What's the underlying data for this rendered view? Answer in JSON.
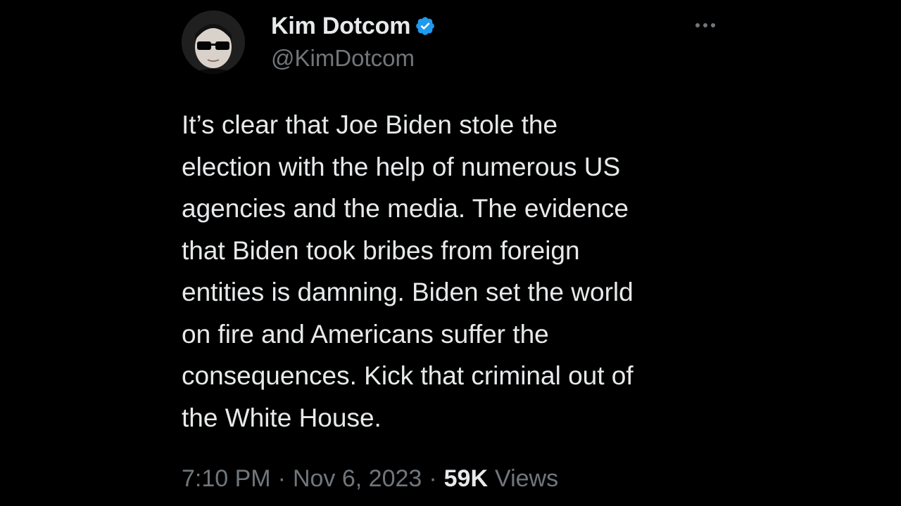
{
  "author": {
    "display_name": "Kim Dotcom",
    "handle": "@KimDotcom",
    "verified_icon": "verified-badge-icon",
    "verified_color": "#1d9bf0"
  },
  "menu": {
    "icon": "more-horizontal-icon"
  },
  "tweet": {
    "text": "It’s clear that Joe Biden stole the\nelection with the help of numerous US\nagencies and the media. The evidence\nthat Biden took bribes from foreign\nentities is damning. Biden set the world\non fire and Americans suffer the\nconsequences. Kick that criminal out of\nthe White House."
  },
  "meta": {
    "time": "7:10 PM",
    "separator": "·",
    "date": "Nov 6, 2023",
    "views_count": "59K",
    "views_label": "Views"
  },
  "colors": {
    "background": "#000000",
    "primary_text": "#e7e9ea",
    "secondary_text": "#71767b"
  }
}
